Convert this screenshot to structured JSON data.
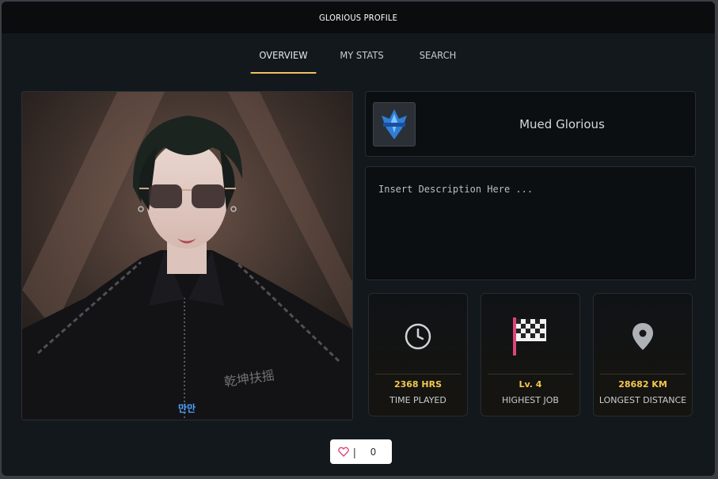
{
  "window": {
    "title": "GLORIOUS PROFILE"
  },
  "tabs": [
    {
      "label": "OVERVIEW",
      "active": true
    },
    {
      "label": "MY STATS",
      "active": false
    },
    {
      "label": "SEARCH",
      "active": false
    }
  ],
  "profile": {
    "name": "Mued Glorious",
    "description_placeholder": "Insert Description Here ...",
    "photo_watermark": "만만",
    "photo_jacket_text": "乾坤扶摇"
  },
  "stats": [
    {
      "value": "2368 HRS",
      "label": "TIME PLAYED",
      "icon": "clock-icon"
    },
    {
      "value": "Lv. 4",
      "label": "HIGHEST JOB",
      "icon": "checkered-flag-icon"
    },
    {
      "value": "28682 KM",
      "label": "LONGEST DISTANCE",
      "icon": "location-pin-icon"
    }
  ],
  "likes": {
    "count": "0",
    "icon": "heart-icon"
  },
  "colors": {
    "accent": "#f0c060",
    "stat_value": "#f3c84e",
    "background": "#13181d",
    "card": "#0c0f12",
    "heart": "#e0457a"
  }
}
